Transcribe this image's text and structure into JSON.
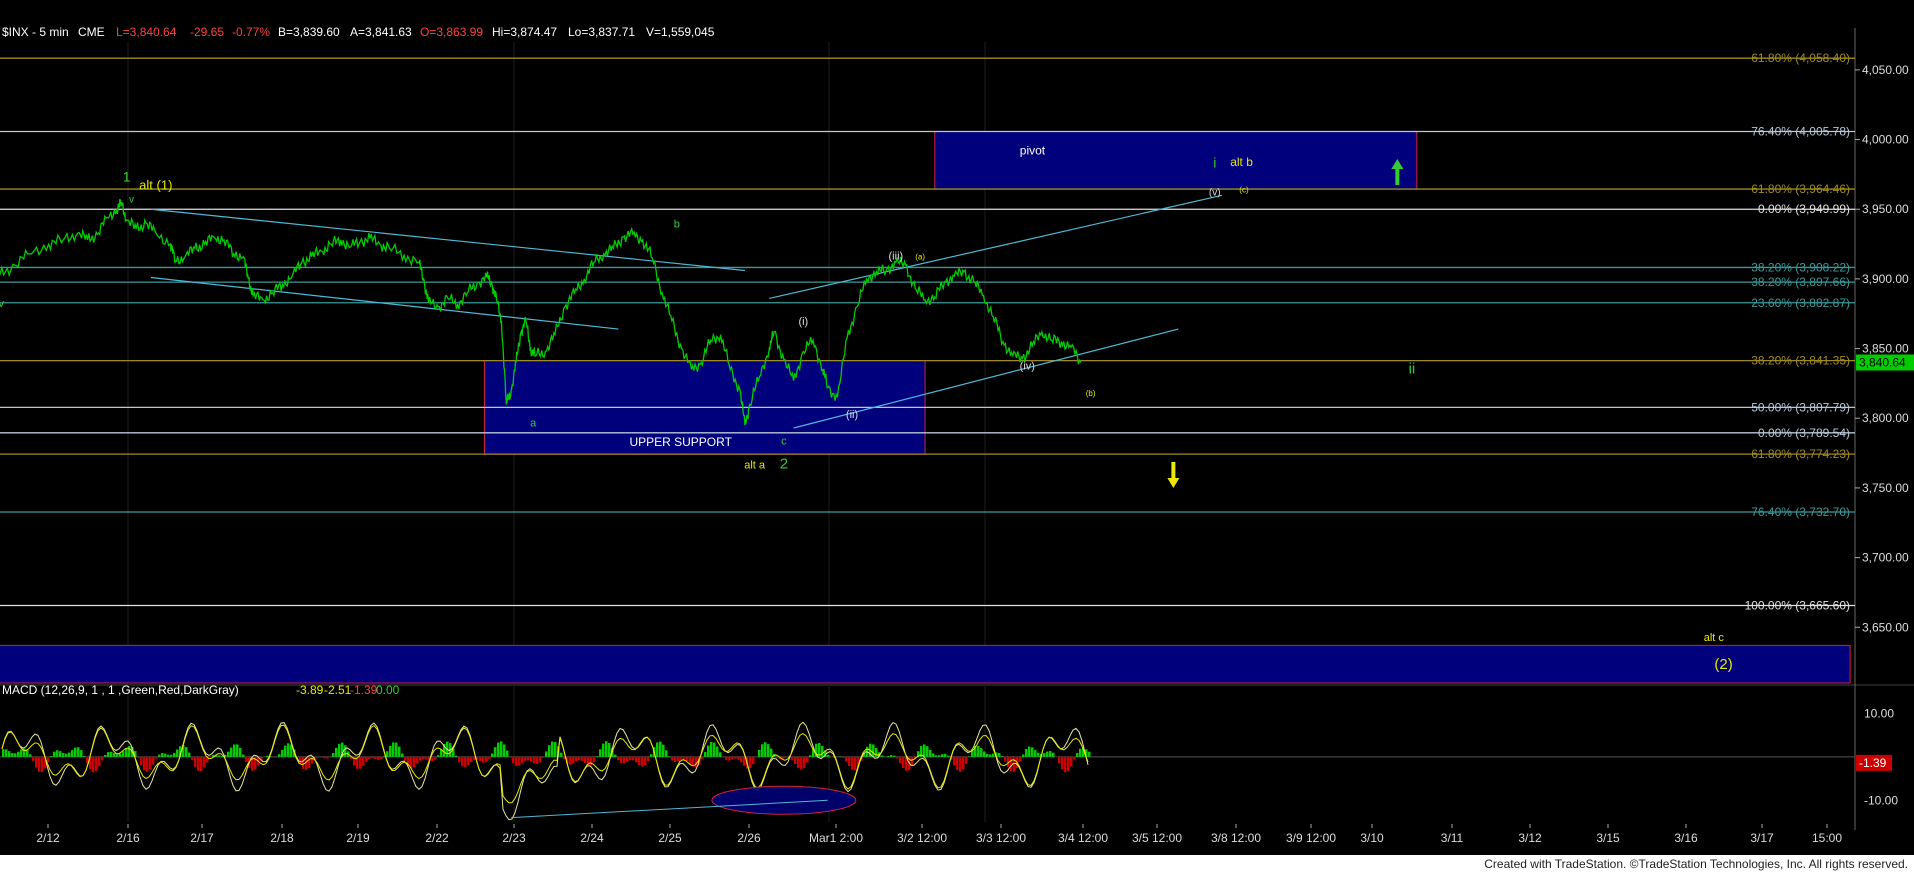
{
  "header": {
    "symbol": "$INX - 5 min",
    "exchange": "CME",
    "last": "L=3,840.64",
    "chg": "-29.65",
    "chg_pct": "-0.77%",
    "bid": "B=3,839.60",
    "ask": "A=3,841.63",
    "open": "O=3,863.99",
    "hi": "Hi=3,874.47",
    "lo": "Lo=3,837.71",
    "vol": "V=1,559,045"
  },
  "footer_credit": "Created with TradeStation. ©TradeStation Technologies, Inc. All rights reserved.",
  "macd_header": {
    "label": "MACD (12,26,9, 1 , 1 ,Green,Red,DarkGray)",
    "v1": "-3.89",
    "v2": "-2.51",
    "v3": "-1.39",
    "v4": "0.00"
  },
  "colors": {
    "bg": "#000000",
    "price": "#00cc00",
    "trend": "#4fb8d8",
    "box": "#00007c",
    "box_border": "#d0203c",
    "yellow": "#e8e800",
    "green_label": "#33cc33"
  },
  "chart_data": {
    "type": "line",
    "title": "$INX - 5 min",
    "price_axis": {
      "ylim": [
        3610,
        4070
      ],
      "ticks": [
        "4,050.00",
        "4,000.00",
        "3,950.00",
        "3,900.00",
        "3,850.00",
        "3,800.00",
        "3,750.00",
        "3,700.00",
        "3,650.00"
      ]
    },
    "last_price_tag": "3,840.64",
    "x_ticks": [
      "2/12",
      "2/16",
      "2/17",
      "2/18",
      "2/19",
      "2/22",
      "2/23",
      "2/24",
      "2/25",
      "2/26",
      "Mar1 2:00",
      "3/2 12:00",
      "3/3 12:00",
      "3/4 12:00",
      "3/5 12:00",
      "3/8 12:00",
      "3/9 12:00",
      "3/10",
      "3/11",
      "3/12",
      "3/15",
      "3/16",
      "3/17",
      "15:00"
    ],
    "price_series": [
      [
        0,
        3903
      ],
      [
        0.3,
        3910
      ],
      [
        0.6,
        3918
      ],
      [
        1.0,
        3925
      ],
      [
        1.3,
        3928
      ],
      [
        1.6,
        3933
      ],
      [
        1.8,
        3928
      ],
      [
        2.0,
        3932
      ],
      [
        2.2,
        3944
      ],
      [
        2.4,
        3950
      ],
      [
        2.5,
        3955
      ],
      [
        2.6,
        3942
      ],
      [
        2.8,
        3936
      ],
      [
        3.0,
        3940
      ],
      [
        3.2,
        3933
      ],
      [
        3.5,
        3925
      ],
      [
        3.6,
        3913
      ],
      [
        3.8,
        3916
      ],
      [
        4.0,
        3922
      ],
      [
        4.2,
        3925
      ],
      [
        4.4,
        3930
      ],
      [
        4.6,
        3928
      ],
      [
        4.8,
        3918
      ],
      [
        5.0,
        3916
      ],
      [
        5.1,
        3900
      ],
      [
        5.2,
        3888
      ],
      [
        5.4,
        3885
      ],
      [
        5.6,
        3890
      ],
      [
        5.8,
        3896
      ],
      [
        6.0,
        3902
      ],
      [
        6.2,
        3912
      ],
      [
        6.4,
        3916
      ],
      [
        6.6,
        3920
      ],
      [
        6.8,
        3925
      ],
      [
        7.0,
        3928
      ],
      [
        7.2,
        3923
      ],
      [
        7.4,
        3927
      ],
      [
        7.6,
        3929
      ],
      [
        7.8,
        3925
      ],
      [
        8.0,
        3922
      ],
      [
        8.3,
        3917
      ],
      [
        8.6,
        3912
      ],
      [
        8.7,
        3900
      ],
      [
        8.8,
        3883
      ],
      [
        9.0,
        3880
      ],
      [
        9.2,
        3886
      ],
      [
        9.4,
        3882
      ],
      [
        9.6,
        3890
      ],
      [
        9.8,
        3897
      ],
      [
        10.0,
        3901
      ],
      [
        10.1,
        3897
      ],
      [
        10.2,
        3885
      ],
      [
        10.3,
        3870
      ],
      [
        10.4,
        3810
      ],
      [
        10.5,
        3820
      ],
      [
        10.6,
        3840
      ],
      [
        10.7,
        3862
      ],
      [
        10.8,
        3870
      ],
      [
        10.9,
        3850
      ],
      [
        11.0,
        3845
      ],
      [
        11.2,
        3848
      ],
      [
        11.4,
        3860
      ],
      [
        11.6,
        3880
      ],
      [
        11.8,
        3890
      ],
      [
        12.0,
        3900
      ],
      [
        12.2,
        3912
      ],
      [
        12.4,
        3918
      ],
      [
        12.6,
        3922
      ],
      [
        12.8,
        3930
      ],
      [
        13.0,
        3932
      ],
      [
        13.2,
        3928
      ],
      [
        13.4,
        3915
      ],
      [
        13.6,
        3890
      ],
      [
        13.8,
        3870
      ],
      [
        14.0,
        3850
      ],
      [
        14.2,
        3835
      ],
      [
        14.4,
        3840
      ],
      [
        14.6,
        3856
      ],
      [
        14.8,
        3860
      ],
      [
        15.0,
        3835
      ],
      [
        15.2,
        3820
      ],
      [
        15.3,
        3795
      ],
      [
        15.4,
        3810
      ],
      [
        15.6,
        3830
      ],
      [
        15.8,
        3850
      ],
      [
        15.9,
        3862
      ],
      [
        16.1,
        3842
      ],
      [
        16.3,
        3827
      ],
      [
        16.5,
        3848
      ],
      [
        16.7,
        3856
      ],
      [
        16.9,
        3835
      ],
      [
        17.0,
        3822
      ],
      [
        17.2,
        3815
      ],
      [
        17.4,
        3858
      ],
      [
        17.6,
        3880
      ],
      [
        17.8,
        3900
      ],
      [
        18.0,
        3905
      ],
      [
        18.2,
        3906
      ],
      [
        18.4,
        3912
      ],
      [
        18.6,
        3910
      ],
      [
        18.8,
        3893
      ],
      [
        19.0,
        3885
      ],
      [
        19.2,
        3887
      ],
      [
        19.4,
        3898
      ],
      [
        19.6,
        3902
      ],
      [
        19.8,
        3905
      ],
      [
        20.0,
        3898
      ],
      [
        20.2,
        3888
      ],
      [
        20.4,
        3873
      ],
      [
        20.6,
        3855
      ],
      [
        20.8,
        3845
      ],
      [
        21.0,
        3843
      ],
      [
        21.2,
        3852
      ],
      [
        21.4,
        3862
      ],
      [
        21.6,
        3856
      ],
      [
        21.8,
        3855
      ],
      [
        22.0,
        3851
      ],
      [
        22.2,
        3840
      ]
    ],
    "fib_lines": [
      {
        "label": "61.80% (4,058.40)",
        "price": 4058.4,
        "color": "#a08c1e"
      },
      {
        "label": "76.40% (4,005.78)",
        "price": 4005.78,
        "color": "#b8c8d8"
      },
      {
        "label": "61.80% (3,964.46)",
        "price": 3964.46,
        "color": "#a08c1e"
      },
      {
        "label": "0.00% (3,949.99)",
        "price": 3949.99,
        "color": "#e0e0e0"
      },
      {
        "label": "38.20% (3,908.22)",
        "price": 3908.22,
        "color": "#3a9a9a"
      },
      {
        "label": "38.20% (3,897.66)",
        "price": 3897.66,
        "color": "#3a9a9a"
      },
      {
        "label": "23.60% (3,882.87)",
        "price": 3882.87,
        "color": "#3a9a9a"
      },
      {
        "label": "38.20% (3,841.35)",
        "price": 3841.35,
        "color": "#a08c1e"
      },
      {
        "label": "50.00% (3,807.79)",
        "price": 3807.79,
        "color": "#b8c8d8"
      },
      {
        "label": "0.00% (3,789.54)",
        "price": 3789.54,
        "color": "#b8c8d8"
      },
      {
        "label": "61.80% (3,774.23)",
        "price": 3774.23,
        "color": "#a08c1e"
      },
      {
        "label": "76.40% (3,732.70)",
        "price": 3732.7,
        "color": "#3a9a9a"
      },
      {
        "label": "100.00% (3,665.60)",
        "price": 3665.6,
        "color": "#e0e0e0"
      }
    ],
    "zones": [
      {
        "label": "pivot",
        "x0": 19.2,
        "x1": 29.1,
        "p0": 3964.46,
        "p1": 4005.78
      },
      {
        "label": "UPPER SUPPORT",
        "x0": 9.95,
        "x1": 19.0,
        "p0": 3774.23,
        "p1": 3841.35
      },
      {
        "label": "",
        "x0": -0.1,
        "x1": 38.0,
        "p0": 3610,
        "p1": 3637
      }
    ],
    "labels": [
      {
        "text": "1",
        "x": 2.6,
        "p": 3970,
        "color": "#33cc33",
        "size": 14
      },
      {
        "text": "v",
        "x": 2.7,
        "p": 3955,
        "color": "#33cc33",
        "size": 10
      },
      {
        "text": "alt (1)",
        "x": 3.2,
        "p": 3964,
        "color": "#e8e800",
        "size": 13
      },
      {
        "text": "iv",
        "x": 0.0,
        "p": 3880,
        "color": "#33cc33",
        "size": 11
      },
      {
        "text": "b",
        "x": 13.9,
        "p": 3937,
        "color": "#33cc33",
        "size": 11
      },
      {
        "text": "a",
        "x": 10.95,
        "p": 3794,
        "color": "#33cc33",
        "size": 11
      },
      {
        "text": "c",
        "x": 16.1,
        "p": 3781,
        "color": "#33cc33",
        "size": 11
      },
      {
        "text": "alt a",
        "x": 15.5,
        "p": 3764,
        "color": "#e8e800",
        "size": 11
      },
      {
        "text": "2",
        "x": 16.1,
        "p": 3764,
        "color": "#33cc33",
        "size": 15
      },
      {
        "text": "(i)",
        "x": 16.5,
        "p": 3867,
        "color": "#dddddd",
        "size": 11
      },
      {
        "text": "(ii)",
        "x": 17.5,
        "p": 3800,
        "color": "#dddddd",
        "size": 11
      },
      {
        "text": "(iii)",
        "x": 18.4,
        "p": 3914,
        "color": "#dddddd",
        "size": 11
      },
      {
        "text": "(a)",
        "x": 18.9,
        "p": 3914,
        "color": "#e8e800",
        "size": 8
      },
      {
        "text": "(iv)",
        "x": 21.1,
        "p": 3835,
        "color": "#dddddd",
        "size": 11
      },
      {
        "text": "(b)",
        "x": 22.4,
        "p": 3816,
        "color": "#e8e800",
        "size": 8
      },
      {
        "text": "i",
        "x": 24.95,
        "p": 3980,
        "color": "#33cc33",
        "size": 14
      },
      {
        "text": "alt b",
        "x": 25.5,
        "p": 3981,
        "color": "#e8e800",
        "size": 12
      },
      {
        "text": "(v)",
        "x": 24.95,
        "p": 3960,
        "color": "#dddddd",
        "size": 10
      },
      {
        "text": "(c)",
        "x": 25.55,
        "p": 3962,
        "color": "#e8e800",
        "size": 8
      },
      {
        "text": "ii",
        "x": 29.0,
        "p": 3832,
        "color": "#33cc33",
        "size": 15
      },
      {
        "text": "alt c",
        "x": 35.2,
        "p": 3640,
        "color": "#e8e800",
        "size": 11
      },
      {
        "text": "(2)",
        "x": 35.4,
        "p": 3620,
        "color": "#e8e800",
        "size": 15
      }
    ],
    "trendlines": [
      {
        "x0": 3.1,
        "p0": 3950,
        "x1": 15.3,
        "p1": 3906
      },
      {
        "x0": 3.1,
        "p0": 3901,
        "x1": 12.7,
        "p1": 3864
      },
      {
        "x0": 15.8,
        "p0": 3886,
        "x1": 25.1,
        "p1": 3960
      },
      {
        "x0": 16.3,
        "p0": 3793,
        "x1": 24.2,
        "p1": 3864
      }
    ],
    "arrows": [
      {
        "dir": "up",
        "x": 28.7,
        "p": 3976,
        "color": "#33cc33"
      },
      {
        "dir": "down",
        "x": 24.1,
        "p": 3760,
        "color": "#e8e800"
      }
    ],
    "macd": {
      "ticks": [
        "10.00",
        "-10.00"
      ],
      "last": "-1.39",
      "ylim": [
        -15,
        14
      ]
    }
  }
}
